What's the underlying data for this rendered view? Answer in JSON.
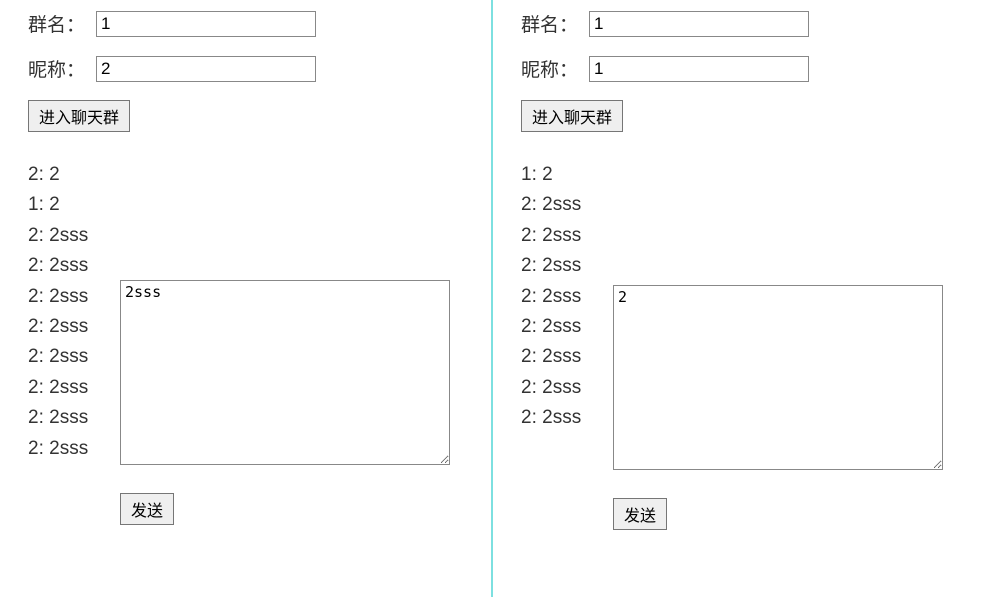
{
  "left": {
    "group_label": "群名：",
    "group_value": "1",
    "nick_label": "昵称：",
    "nick_value": "2",
    "enter_label": "进入聊天群",
    "messages": [
      "2: 2",
      "1: 2",
      "2: 2sss",
      "2: 2sss",
      "2: 2sss",
      "2: 2sss",
      "2: 2sss",
      "2: 2sss",
      "2: 2sss",
      "2: 2sss"
    ],
    "compose_value": "2sss",
    "send_label": "发送"
  },
  "right": {
    "group_label": "群名：",
    "group_value": "1",
    "nick_label": "昵称：",
    "nick_value": "1",
    "enter_label": "进入聊天群",
    "messages": [
      "1: 2",
      "2: 2sss",
      "2: 2sss",
      "2: 2sss",
      "2: 2sss",
      "2: 2sss",
      "2: 2sss",
      "2: 2sss",
      "2: 2sss"
    ],
    "compose_value": "2",
    "send_label": "发送"
  }
}
